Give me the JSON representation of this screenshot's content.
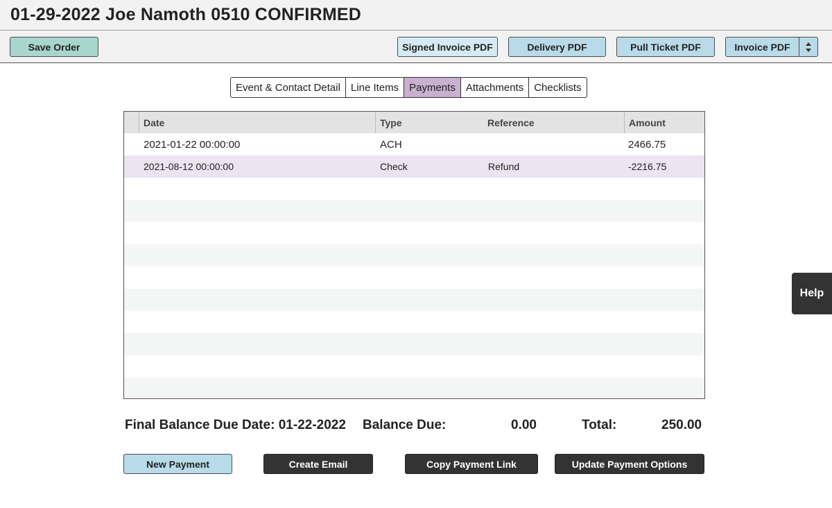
{
  "header": {
    "title": "01-29-2022 Joe Namoth 0510 CONFIRMED"
  },
  "toolbar": {
    "save_order": "Save Order",
    "signed_invoice_pdf": "Signed Invoice PDF",
    "delivery_pdf": "Delivery PDF",
    "pull_ticket_pdf": "Pull Ticket PDF",
    "invoice_pdf": "Invoice PDF"
  },
  "tabs": [
    {
      "label": "Event & Contact Detail",
      "active": false
    },
    {
      "label": "Line Items",
      "active": false
    },
    {
      "label": "Payments",
      "active": true
    },
    {
      "label": "Attachments",
      "active": false
    },
    {
      "label": "Checklists",
      "active": false
    }
  ],
  "payments_table": {
    "columns": [
      "Date",
      "Type",
      "Reference",
      "Amount"
    ],
    "rows": [
      {
        "date": "2021-01-22 00:00:00",
        "type": "ACH",
        "reference": "",
        "amount": "2466.75"
      },
      {
        "date": "2021-08-12 00:00:00",
        "type": "Check",
        "reference": "Refund",
        "amount": "-2216.75"
      }
    ]
  },
  "summary": {
    "final_balance_due_date_label": "Final Balance Due Date: 01-22-2022",
    "balance_due_label": "Balance Due:",
    "balance_due_value": "0.00",
    "total_label": "Total:",
    "total_value": "250.00"
  },
  "actions": {
    "new_payment": "New Payment",
    "create_email": "Create Email",
    "copy_payment_link": "Copy Payment Link",
    "update_payment_options": "Update Payment Options"
  },
  "help": {
    "label": "Help"
  },
  "colors": {
    "accent_green": "#a8d6cc",
    "accent_blue": "#b9dbe9",
    "active_tab": "#c9b0cf",
    "selected_row": "#ece4f0",
    "dark_button": "#333333"
  }
}
